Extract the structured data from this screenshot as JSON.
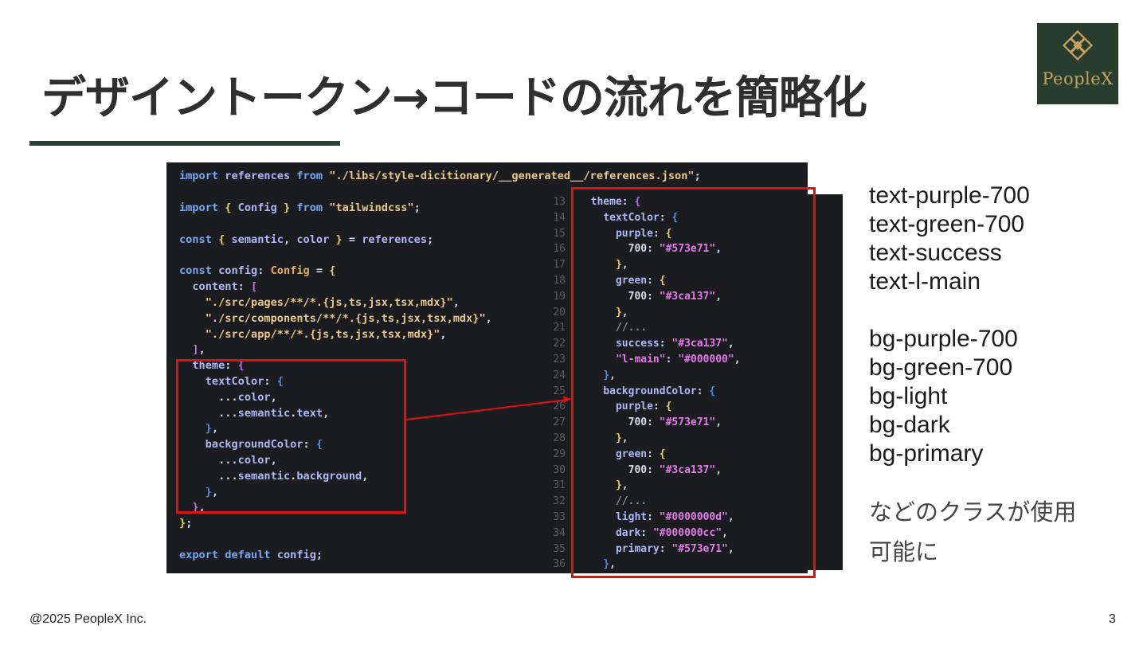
{
  "slide": {
    "title": "デザイントークン→コードの流れを簡略化",
    "logo_text": "PeopleX",
    "footer": "@2025 PeopleX Inc.",
    "page_number": "3",
    "accent_color": "#284436",
    "highlight_color": "#e01010"
  },
  "code_left": {
    "lines": [
      "import references from \"./libs/style-dicitionary/__generated__/references.json\";",
      "",
      "import { Config } from \"tailwindcss\";",
      "",
      "const { semantic, color } = references;",
      "",
      "const config: Config = {",
      "  content: [",
      "    \"./src/pages/**/*.{js,ts,jsx,tsx,mdx}\",",
      "    \"./src/components/**/*.{js,ts,jsx,tsx,mdx}\",",
      "    \"./src/app/**/*.{js,ts,jsx,tsx,mdx}\",",
      "  ],",
      "  theme: {",
      "    textColor: {",
      "      ...color,",
      "      ...semantic.text,",
      "    },",
      "    backgroundColor: {",
      "      ...color,",
      "      ...semantic.background,",
      "    },",
      "  },",
      "};",
      "",
      "export default config;"
    ]
  },
  "code_right": {
    "line_numbers": [
      "13",
      "14",
      "15",
      "16",
      "17",
      "18",
      "19",
      "20",
      "21",
      "22",
      "23",
      "24",
      "25",
      "26",
      "27",
      "28",
      "29",
      "30",
      "31",
      "32",
      "33",
      "34",
      "35",
      "36"
    ],
    "lines": [
      "  theme: {",
      "    textColor: {",
      "      purple: {",
      "        700: \"#573e71\",",
      "      },",
      "      green: {",
      "        700: \"#3ca137\",",
      "      },",
      "      //...",
      "      success: \"#3ca137\",",
      "      \"l-main\": \"#000000\",",
      "    },",
      "    backgroundColor: {",
      "      purple: {",
      "        700: \"#573e71\",",
      "      },",
      "      green: {",
      "        700: \"#3ca137\",",
      "      },",
      "      //...",
      "      light: \"#0000000d\",",
      "      dark: \"#000000cc\",",
      "      primary: \"#573e71\",",
      "    },"
    ]
  },
  "text_classes": [
    "text-purple-700",
    "text-green-700",
    "text-success",
    "text-l-main"
  ],
  "bg_classes": [
    "bg-purple-700",
    "bg-green-700",
    "bg-light",
    "bg-dark",
    "bg-primary"
  ],
  "note": "などのクラスが使用可能に"
}
